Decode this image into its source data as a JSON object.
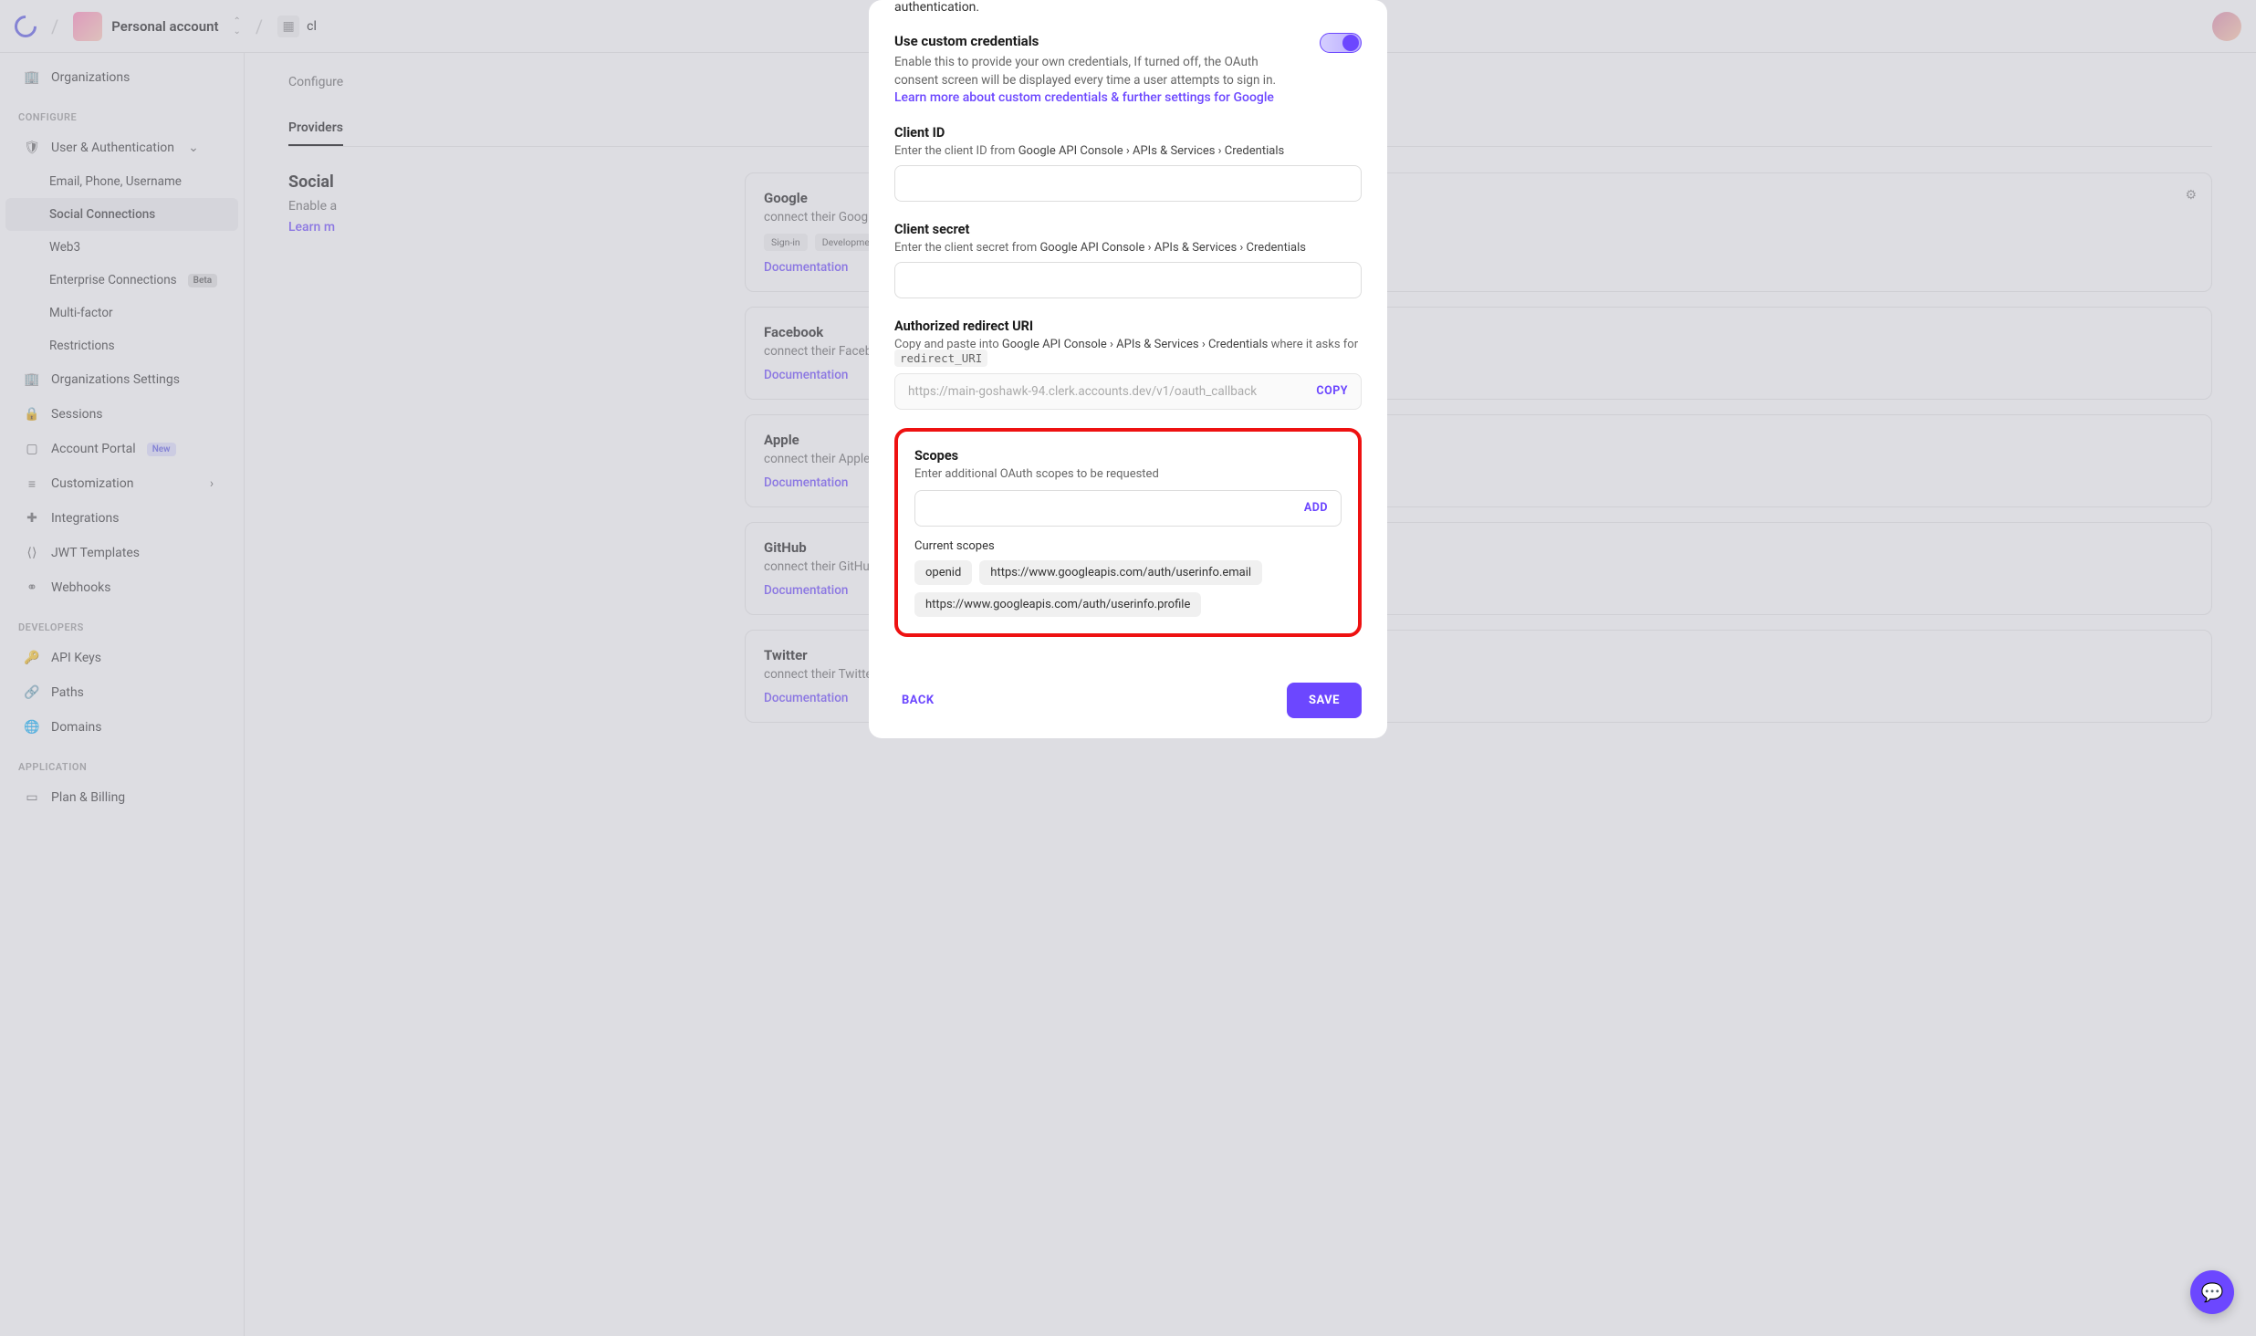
{
  "topbar": {
    "account_label": "Personal account",
    "app_initial": "cl"
  },
  "sidebar": {
    "org_label": "Organizations",
    "heading_configure": "CONFIGURE",
    "heading_developers": "DEVELOPERS",
    "heading_application": "APPLICATION",
    "user_auth": "User & Authentication",
    "subs": {
      "email": "Email, Phone, Username",
      "social": "Social Connections",
      "web3": "Web3",
      "enterprise": "Enterprise Connections",
      "enterprise_badge": "Beta",
      "multi": "Multi-factor",
      "restrict": "Restrictions"
    },
    "org_settings": "Organizations Settings",
    "sessions": "Sessions",
    "account_portal": "Account Portal",
    "account_portal_badge": "New",
    "customization": "Customization",
    "integrations": "Integrations",
    "jwt": "JWT Templates",
    "webhooks": "Webhooks",
    "api_keys": "API Keys",
    "paths": "Paths",
    "domains": "Domains",
    "plan": "Plan & Billing"
  },
  "content": {
    "config_prefix": "Configure ",
    "tab_providers": "Providers",
    "left": {
      "title_prefix": "Social",
      "desc_prefix": "Enable a",
      "learn_more": "Learn m"
    },
    "providers": [
      {
        "name": "Google",
        "desc_suffix": "connect their Google account",
        "badges": [
          "Sign-in",
          "Development mode"
        ],
        "doc": "Documentation",
        "gear": true
      },
      {
        "name": "Facebook",
        "desc_suffix": "connect their Facebook account",
        "doc": "Documentation"
      },
      {
        "name": "Apple",
        "desc_suffix": "connect their Apple account",
        "doc": "Documentation"
      },
      {
        "name": "GitHub",
        "desc_suffix": "connect their GitHub account",
        "doc": "Documentation"
      },
      {
        "name": "Twitter",
        "desc_suffix": "connect their Twitter account",
        "doc": "Documentation"
      }
    ]
  },
  "modal": {
    "trailing": "authentication.",
    "toggle": {
      "title": "Use custom credentials",
      "desc": "Enable this to provide your own credentials, If turned off, the OAuth consent screen will be displayed every time a user attempts to sign in.",
      "link": "Learn more about custom credentials & further settings for Google"
    },
    "client_id": {
      "label": "Client ID",
      "hint_prefix": "Enter the client ID from ",
      "hint_path": "Google API Console › APIs & Services › Credentials"
    },
    "client_secret": {
      "label": "Client secret",
      "hint_prefix": "Enter the client secret from ",
      "hint_path": "Google API Console › APIs & Services › Credentials"
    },
    "redirect": {
      "label": "Authorized redirect URI",
      "hint_prefix": "Copy and paste into ",
      "hint_path": "Google API Console › APIs & Services › Credentials",
      "hint_suffix": " where it asks for ",
      "code": "redirect_URI",
      "url": "https://main-goshawk-94.clerk.accounts.dev/v1/oauth_callback",
      "copy": "COPY"
    },
    "scopes": {
      "label": "Scopes",
      "hint": "Enter additional OAuth scopes to be requested",
      "add": "ADD",
      "current_label": "Current scopes",
      "chips": [
        "openid",
        "https://www.googleapis.com/auth/userinfo.email",
        "https://www.googleapis.com/auth/userinfo.profile"
      ]
    },
    "back": "BACK",
    "save": "SAVE"
  }
}
